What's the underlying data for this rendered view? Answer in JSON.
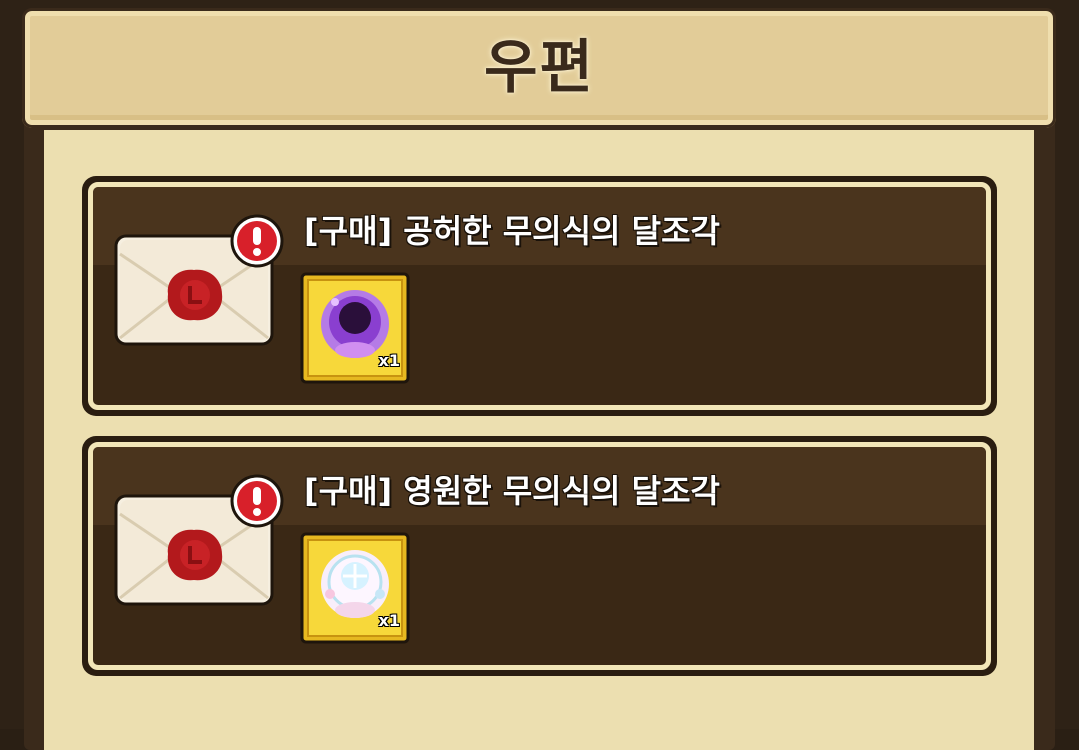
{
  "header": {
    "title": "우편"
  },
  "mails": [
    {
      "title": "[구매] 공허한 무의식의 달조각",
      "item": {
        "name": "void-moon-fragment-icon",
        "quantity": "x1",
        "color": "#8a3fd0"
      }
    },
    {
      "title": "[구매] 영원한 무의식의 달조각",
      "item": {
        "name": "eternal-moon-fragment-icon",
        "quantity": "x1",
        "color": "#f4e6f0"
      }
    }
  ],
  "colors": {
    "panel": "#ecdfb0",
    "mail_bg": "#3a2815",
    "alert": "#d8202a",
    "seal": "#b3191c"
  }
}
